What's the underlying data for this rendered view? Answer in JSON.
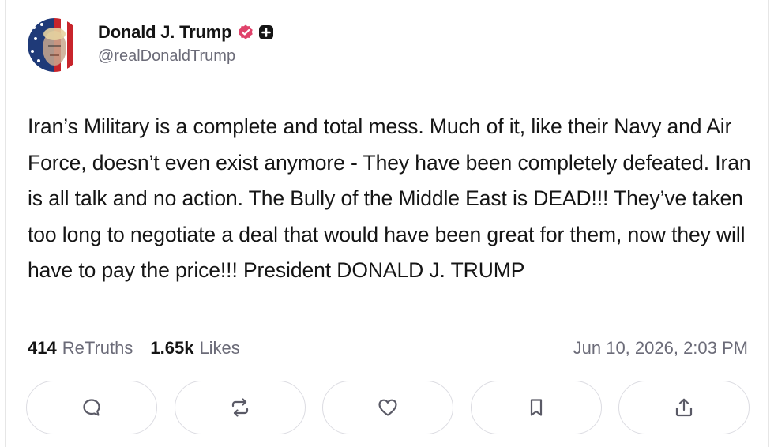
{
  "post": {
    "author": {
      "display_name": "Donald J. Trump",
      "handle": "@realDonaldTrump",
      "verified": true,
      "avatar_icon": "avatar-flag-portrait",
      "badge_icon": "plus-badge-icon"
    },
    "text": "Iran’s Military is a complete and total mess. Much of it, like their Navy and Air Force, doesn’t even exist anymore - They have been completely defeated. Iran is all talk and no action. The Bully of the Middle East is DEAD!!! They’ve taken too long to negotiate a deal that would have been great for them, now they will have to pay the price!!! President DONALD J. TRUMP",
    "stats": {
      "retruths_count": "414",
      "retruths_label": "ReTruths",
      "likes_count": "1.65k",
      "likes_label": "Likes"
    },
    "timestamp": "Jun 10, 2026, 2:03 PM"
  },
  "actions": [
    {
      "name": "reply",
      "icon": "comment-icon"
    },
    {
      "name": "retruth",
      "icon": "repost-icon"
    },
    {
      "name": "like",
      "icon": "heart-icon"
    },
    {
      "name": "bookmark",
      "icon": "bookmark-icon"
    },
    {
      "name": "share",
      "icon": "share-icon"
    }
  ],
  "colors": {
    "text": "#151515",
    "muted": "#6b6b78",
    "verified": "#e0436b",
    "border": "#dcdce2",
    "icon": "#5a5a66"
  }
}
